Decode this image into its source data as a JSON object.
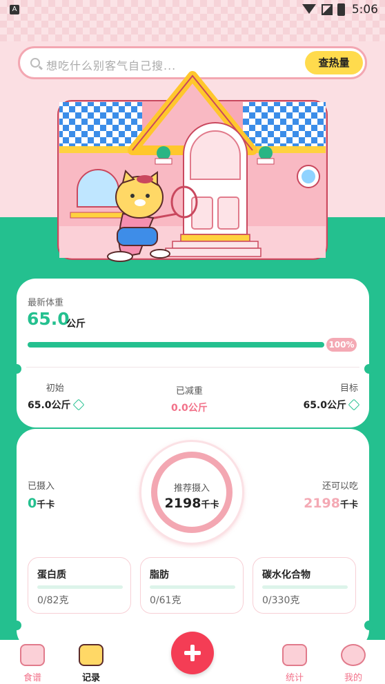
{
  "status_bar": {
    "time": "5:06",
    "app_badge": "A"
  },
  "search": {
    "placeholder": "想吃什么别客气自己搜...",
    "button_label": "查热量"
  },
  "weight_card": {
    "label": "最新体重",
    "value": "65.0",
    "unit": "公斤",
    "progress": 1.0,
    "progress_label": "100%",
    "start_label": "初始",
    "start_value": "65.0公斤",
    "lost_label": "已减重",
    "lost_value": "0.0公斤",
    "target_label": "目标",
    "target_value": "65.0公斤"
  },
  "intake_card": {
    "consumed_label": "已摄入",
    "consumed_value": "0",
    "consumed_unit": "千卡",
    "recommended_label": "推荐摄入",
    "recommended_value": "2198",
    "recommended_unit": "千卡",
    "remaining_label": "还可以吃",
    "remaining_value": "2198",
    "remaining_unit": "千卡",
    "nutrients": [
      {
        "name": "蛋白质",
        "value": "0/82克"
      },
      {
        "name": "脂肪",
        "value": "0/61克"
      },
      {
        "name": "碳水化合物",
        "value": "0/330克"
      }
    ]
  },
  "tabs": [
    {
      "label": "食谱",
      "icon": "recipe-icon"
    },
    {
      "label": "记录",
      "icon": "record-icon"
    },
    {
      "label": "统计",
      "icon": "stats-icon"
    },
    {
      "label": "我的",
      "icon": "profile-icon"
    }
  ],
  "colors": {
    "brand_green": "#24c08f",
    "pink": "#f3a7b2",
    "fab_red": "#f43d55",
    "search_button": "#ffdb4d"
  }
}
